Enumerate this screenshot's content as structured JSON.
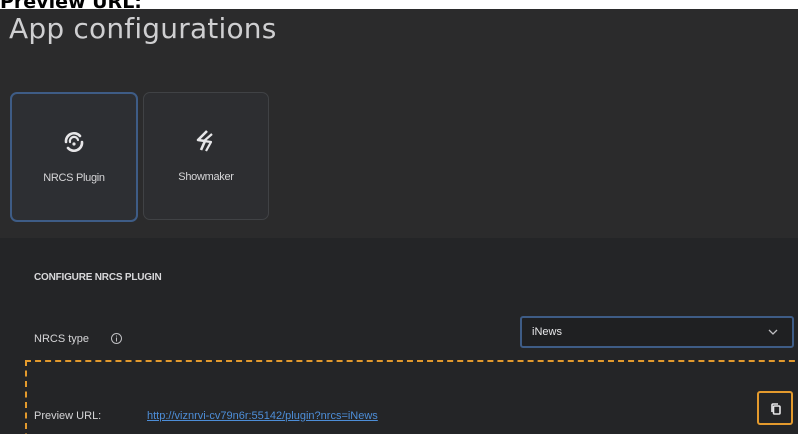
{
  "caption": "Preview URL:",
  "page_title": "App configurations",
  "cards": [
    {
      "label": "NRCS Plugin",
      "icon": "nrcs-plugin-icon",
      "selected": true
    },
    {
      "label": "Showmaker",
      "icon": "showmaker-icon",
      "selected": false
    }
  ],
  "section": {
    "heading": "CONFIGURE NRCS PLUGIN",
    "nrcs_type_label": "NRCS type",
    "nrcs_type_value": "iNews",
    "preview_label": "Preview URL:",
    "preview_url": "http://viznrvi-cv79n6r:55142/plugin?nrcs=iNews"
  },
  "colors": {
    "accent_border": "#3e5c86",
    "highlight": "#e39a2d",
    "link": "#4d8ed8"
  }
}
